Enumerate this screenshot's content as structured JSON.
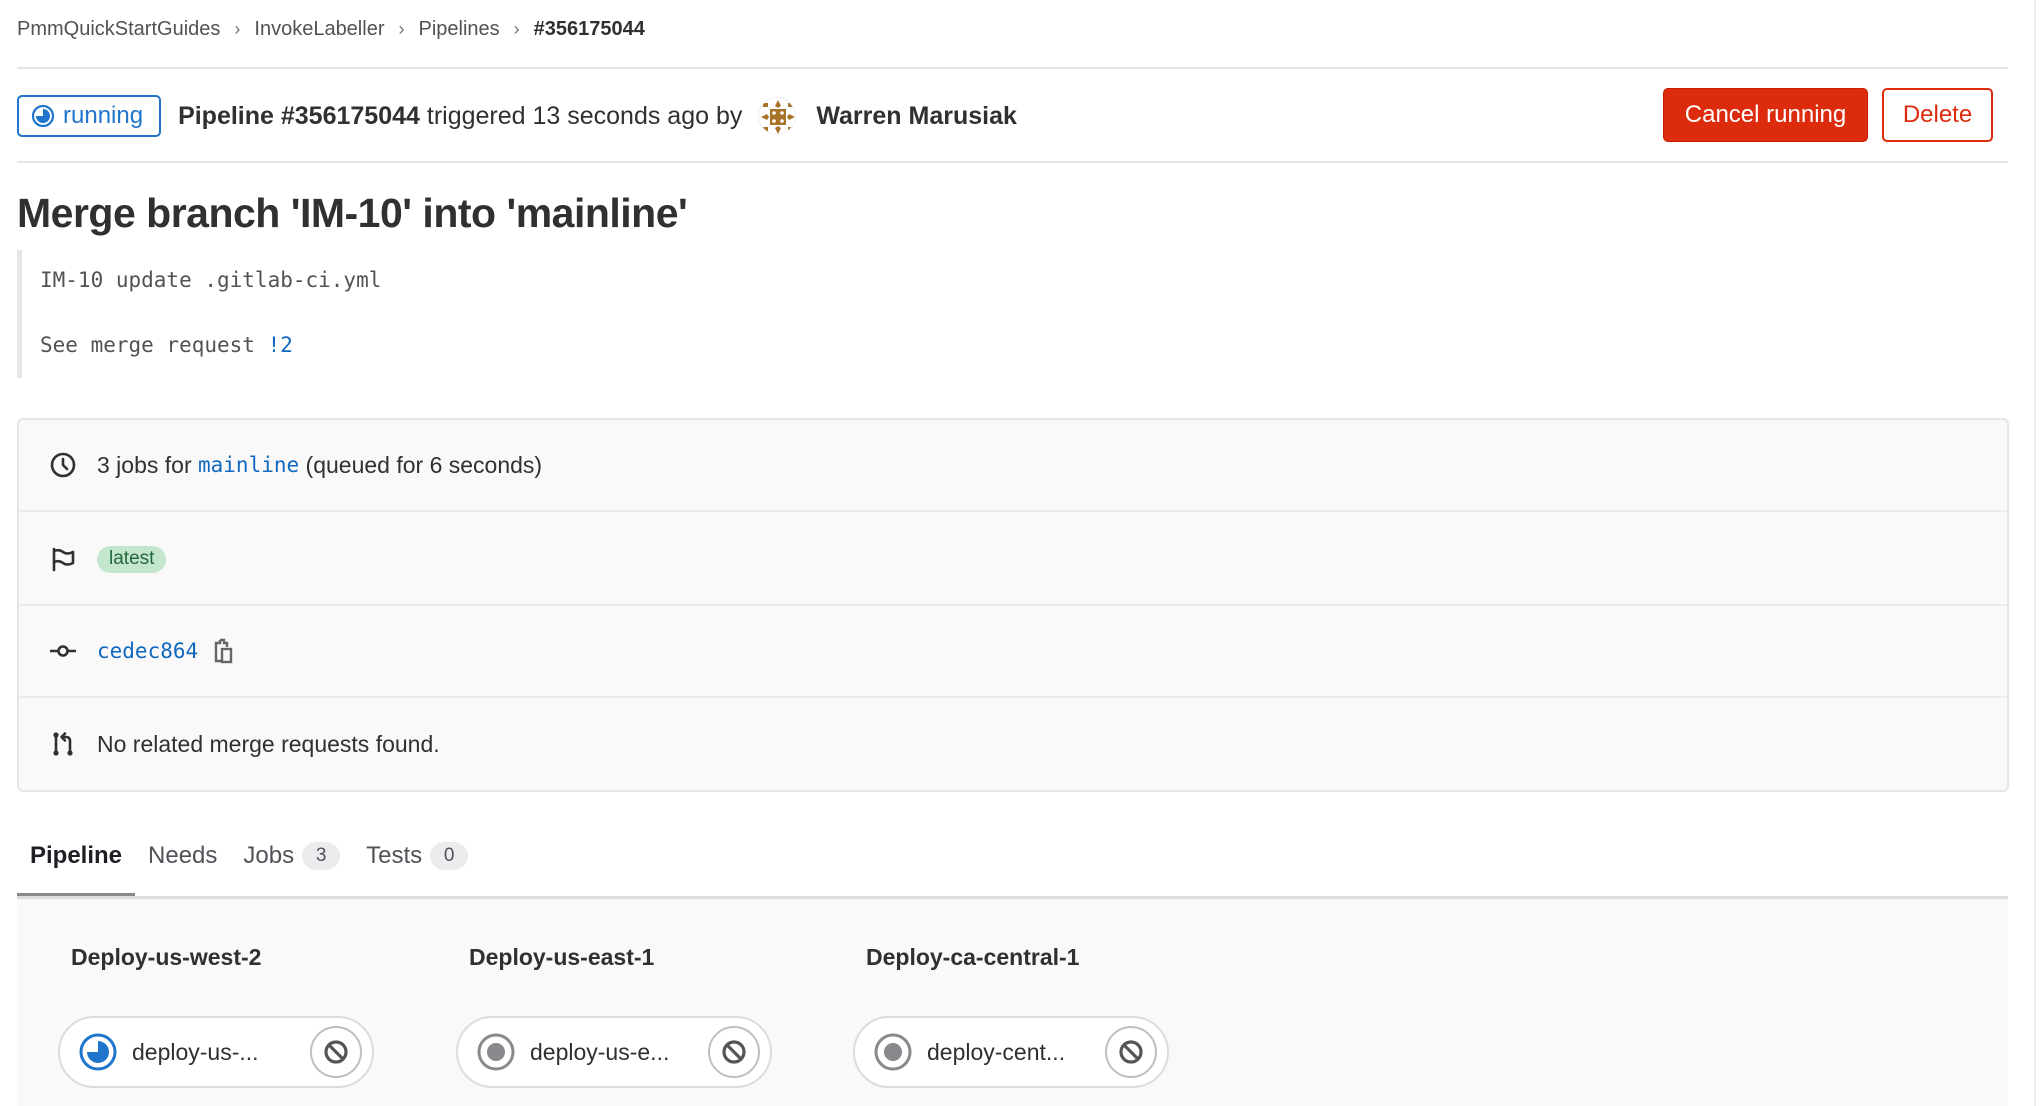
{
  "breadcrumb": {
    "items": [
      "PmmQuickStartGuides",
      "InvokeLabeller",
      "Pipelines",
      "#356175044"
    ],
    "separator": "›"
  },
  "header": {
    "status_label": "running",
    "status_icon": "status-running-icon",
    "pipeline_label": "Pipeline #356175044",
    "triggered_text": " triggered 13 seconds ago by",
    "author": "Warren Marusiak",
    "cancel_label": "Cancel running",
    "delete_label": "Delete"
  },
  "commit": {
    "title": "Merge branch 'IM-10' into 'mainline'",
    "description_line1": "IM-10 update .gitlab-ci.yml",
    "description_line2_prefix": "See merge request ",
    "merge_request_link": "!2"
  },
  "info": {
    "jobs_prefix": "3 jobs for ",
    "branch": "mainline",
    "jobs_suffix": " (queued for 6 seconds)",
    "tag_label": "latest",
    "commit_sha": "cedec864",
    "merge_requests_text": "No related merge requests found."
  },
  "tabs": [
    {
      "label": "Pipeline",
      "active": true
    },
    {
      "label": "Needs",
      "active": false
    },
    {
      "label": "Jobs",
      "count": "3",
      "active": false
    },
    {
      "label": "Tests",
      "count": "0",
      "active": false
    }
  ],
  "stages": [
    {
      "title": "Deploy-us-west-2",
      "job_name": "deploy-us-...",
      "job_status": "running"
    },
    {
      "title": "Deploy-us-east-1",
      "job_name": "deploy-us-e...",
      "job_status": "created"
    },
    {
      "title": "Deploy-ca-central-1",
      "job_name": "deploy-cent...",
      "job_status": "created"
    }
  ],
  "colors": {
    "running_blue": "#1f75cb",
    "danger_red": "#dd2b0e",
    "link_blue": "#1068bf",
    "latest_badge_bg": "#c3e6cd",
    "created_gray": "#89888d"
  }
}
